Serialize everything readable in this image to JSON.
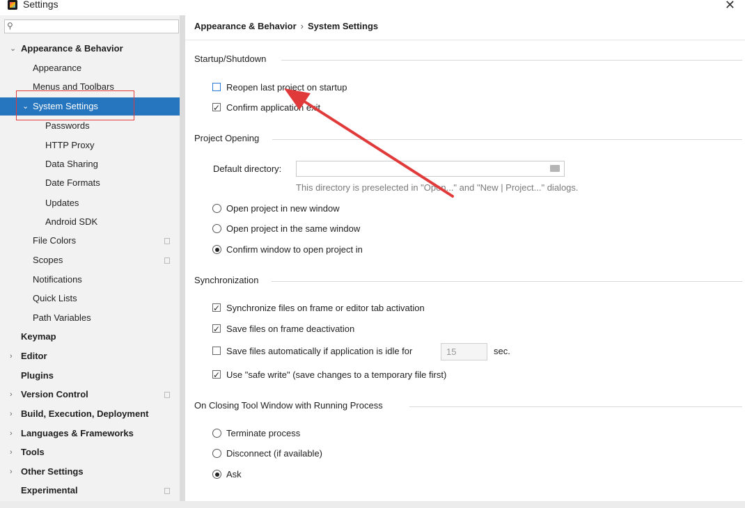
{
  "window": {
    "title": "Settings",
    "close_glyph": "✕"
  },
  "search": {
    "placeholder": "",
    "icon": "search-icon"
  },
  "sidebar": {
    "items": [
      {
        "label": "Appearance & Behavior",
        "arrow": "⌄"
      },
      {
        "label": "Appearance"
      },
      {
        "label": "Menus and Toolbars"
      },
      {
        "label": "System Settings",
        "arrow": "⌄"
      },
      {
        "label": "Passwords"
      },
      {
        "label": "HTTP Proxy"
      },
      {
        "label": "Data Sharing"
      },
      {
        "label": "Date Formats"
      },
      {
        "label": "Updates"
      },
      {
        "label": "Android SDK"
      },
      {
        "label": "File Colors"
      },
      {
        "label": "Scopes"
      },
      {
        "label": "Notifications"
      },
      {
        "label": "Quick Lists"
      },
      {
        "label": "Path Variables"
      },
      {
        "label": "Keymap"
      },
      {
        "label": "Editor",
        "arrow": "›"
      },
      {
        "label": "Plugins"
      },
      {
        "label": "Version Control",
        "arrow": "›"
      },
      {
        "label": "Build, Execution, Deployment",
        "arrow": "›"
      },
      {
        "label": "Languages & Frameworks",
        "arrow": "›"
      },
      {
        "label": "Tools",
        "arrow": "›"
      },
      {
        "label": "Other Settings",
        "arrow": "›"
      },
      {
        "label": "Experimental"
      }
    ]
  },
  "breadcrumb": {
    "parent": "Appearance & Behavior",
    "separator": "›",
    "current": "System Settings"
  },
  "startup": {
    "title": "Startup/Shutdown",
    "reopen_last": {
      "label": "Reopen last project on startup",
      "checked": false
    },
    "confirm_exit": {
      "label": "Confirm application exit",
      "checked": true
    }
  },
  "project_opening": {
    "title": "Project Opening",
    "default_directory_label": "Default directory:",
    "default_directory_value": "",
    "hint": "This directory is preselected in \"Open...\" and \"New | Project...\" dialogs.",
    "options": [
      {
        "label": "Open project in new window",
        "checked": false
      },
      {
        "label": "Open project in the same window",
        "checked": false
      },
      {
        "label": "Confirm window to open project in",
        "checked": true
      }
    ]
  },
  "synchronization": {
    "title": "Synchronization",
    "sync_on_activation": {
      "label": "Synchronize files on frame or editor tab activation",
      "checked": true
    },
    "save_on_deactivation": {
      "label": "Save files on frame deactivation",
      "checked": true
    },
    "save_when_idle": {
      "label": "Save files automatically if application is idle for",
      "checked": false,
      "value": "15",
      "unit": "sec."
    },
    "safe_write": {
      "label": "Use \"safe write\" (save changes to a temporary file first)",
      "checked": true
    }
  },
  "closing_tool_window": {
    "title": "On Closing Tool Window with Running Process",
    "options": [
      {
        "label": "Terminate process",
        "checked": false
      },
      {
        "label": "Disconnect (if available)",
        "checked": false
      },
      {
        "label": "Ask",
        "checked": true
      }
    ]
  },
  "colors": {
    "selection": "#2675bf",
    "annotation_red": "#e03a3a",
    "checkbox_focus": "#2a7bd6"
  }
}
